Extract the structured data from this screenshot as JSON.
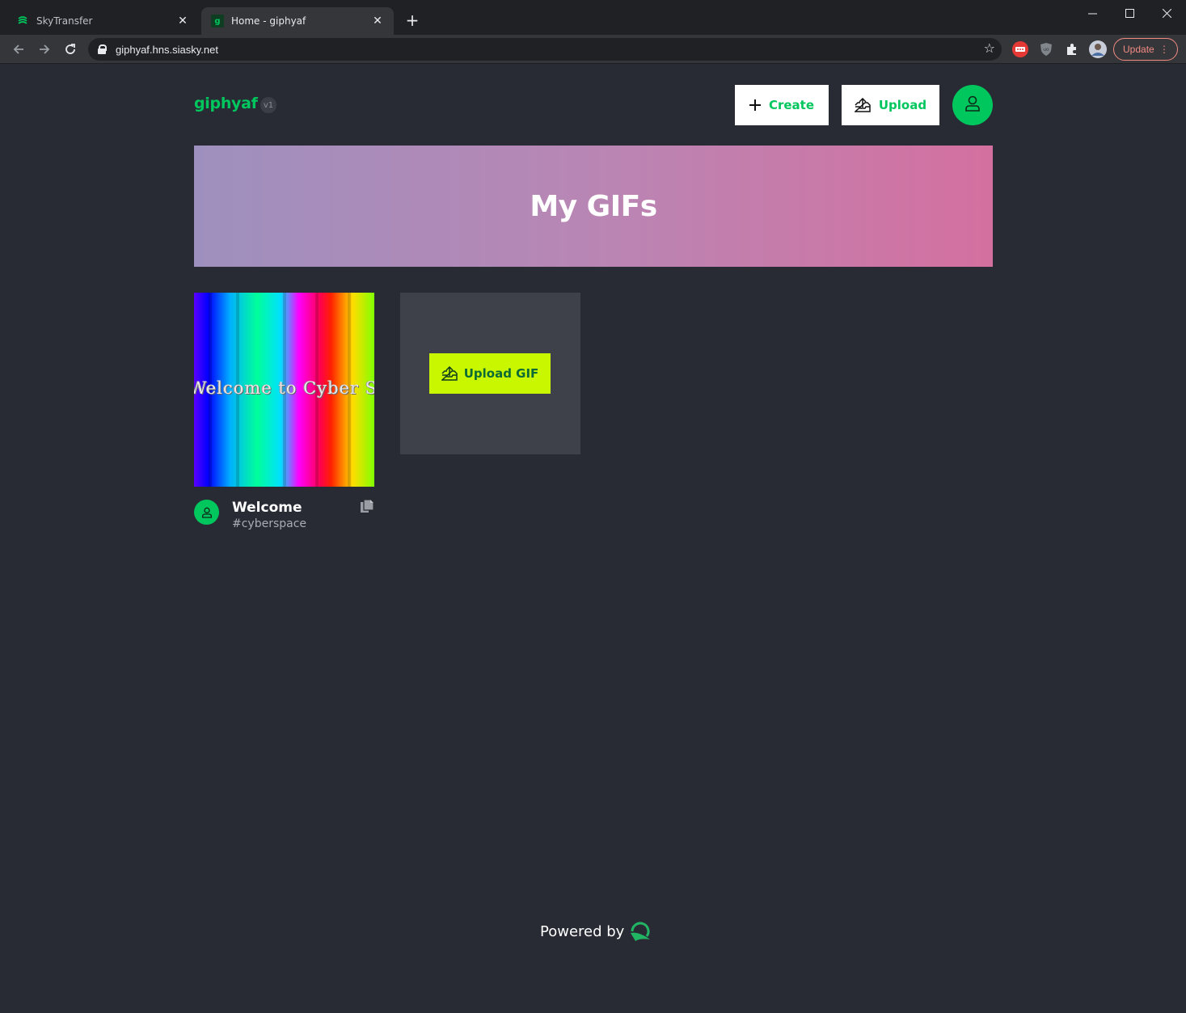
{
  "browser": {
    "tabs": [
      {
        "title": "SkyTransfer",
        "active": false
      },
      {
        "title": "Home - giphyaf",
        "active": true
      }
    ],
    "url": "giphyaf.hns.siasky.net",
    "update_label": "Update"
  },
  "header": {
    "logo": "giphyaf",
    "version": "v1",
    "create_label": "Create",
    "upload_label": "Upload"
  },
  "banner": {
    "title": "My GIFs"
  },
  "gifs": [
    {
      "title": "Welcome",
      "tag": "#cyberspace",
      "thumbnail_text": "Welcome to Cyber Spa"
    }
  ],
  "upload_card": {
    "button_label": "Upload GIF"
  },
  "footer": {
    "powered_by": "Powered by"
  },
  "colors": {
    "accent": "#00c65e",
    "background": "#282b34",
    "upload_button": "#c9f700"
  }
}
